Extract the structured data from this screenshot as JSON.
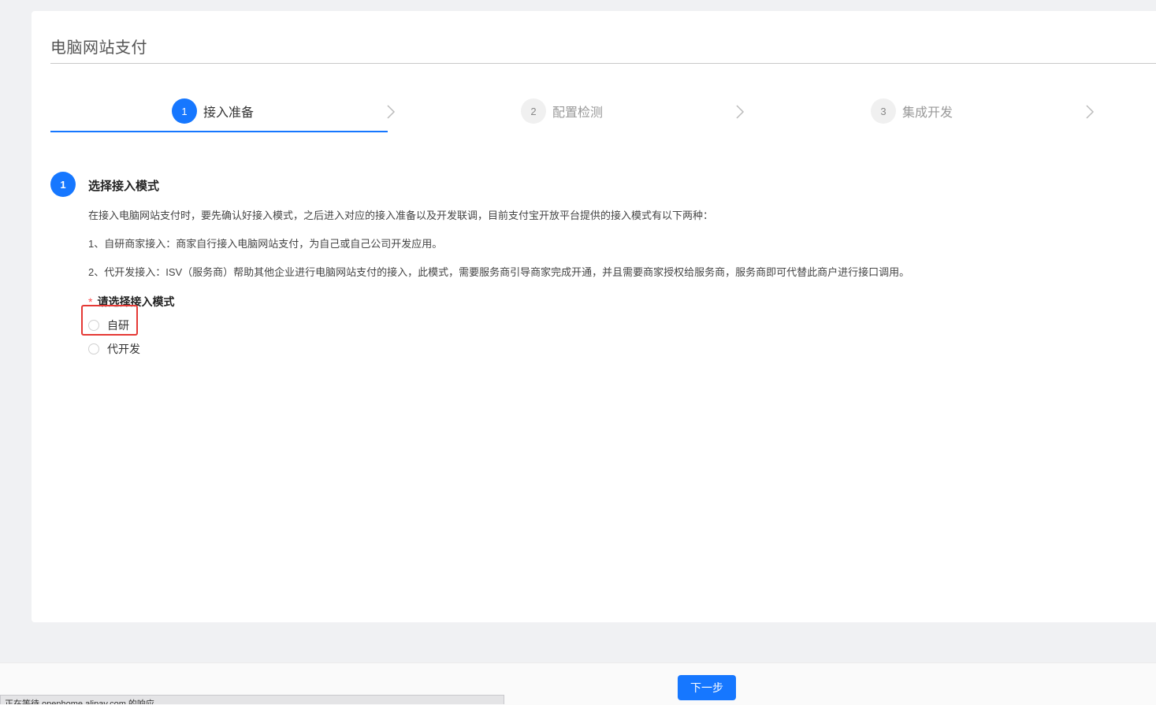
{
  "page": {
    "title": "电脑网站支付"
  },
  "steps": [
    {
      "num": "1",
      "label": "接入准备",
      "state": "active"
    },
    {
      "num": "2",
      "label": "配置检测",
      "state": "inactive"
    },
    {
      "num": "3",
      "label": "集成开发",
      "state": "inactive"
    }
  ],
  "section": {
    "num": "1",
    "title": "选择接入模式",
    "para1": "在接入电脑网站支付时，要先确认好接入模式，之后进入对应的接入准备以及开发联调，目前支付宝开放平台提供的接入模式有以下两种：",
    "para2": "1、自研商家接入：商家自行接入电脑网站支付，为自己或自己公司开发应用。",
    "para3": "2、代开发接入：ISV（服务商）帮助其他企业进行电脑网站支付的接入，此模式，需要服务商引导商家完成开通，并且需要商家授权给服务商，服务商即可代替此商户进行接口调用。"
  },
  "form": {
    "required_mark": "*",
    "label": "请选择接入模式",
    "options": [
      {
        "label": "自研",
        "selected": false
      },
      {
        "label": "代开发",
        "selected": false
      }
    ]
  },
  "footer": {
    "next_label": "下一步"
  },
  "status_bar": {
    "text": "正在等待 openhome.alipay.com 的响应..."
  },
  "colors": {
    "accent": "#1677ff",
    "highlight": "#e53935",
    "required": "#ff4d4f"
  }
}
